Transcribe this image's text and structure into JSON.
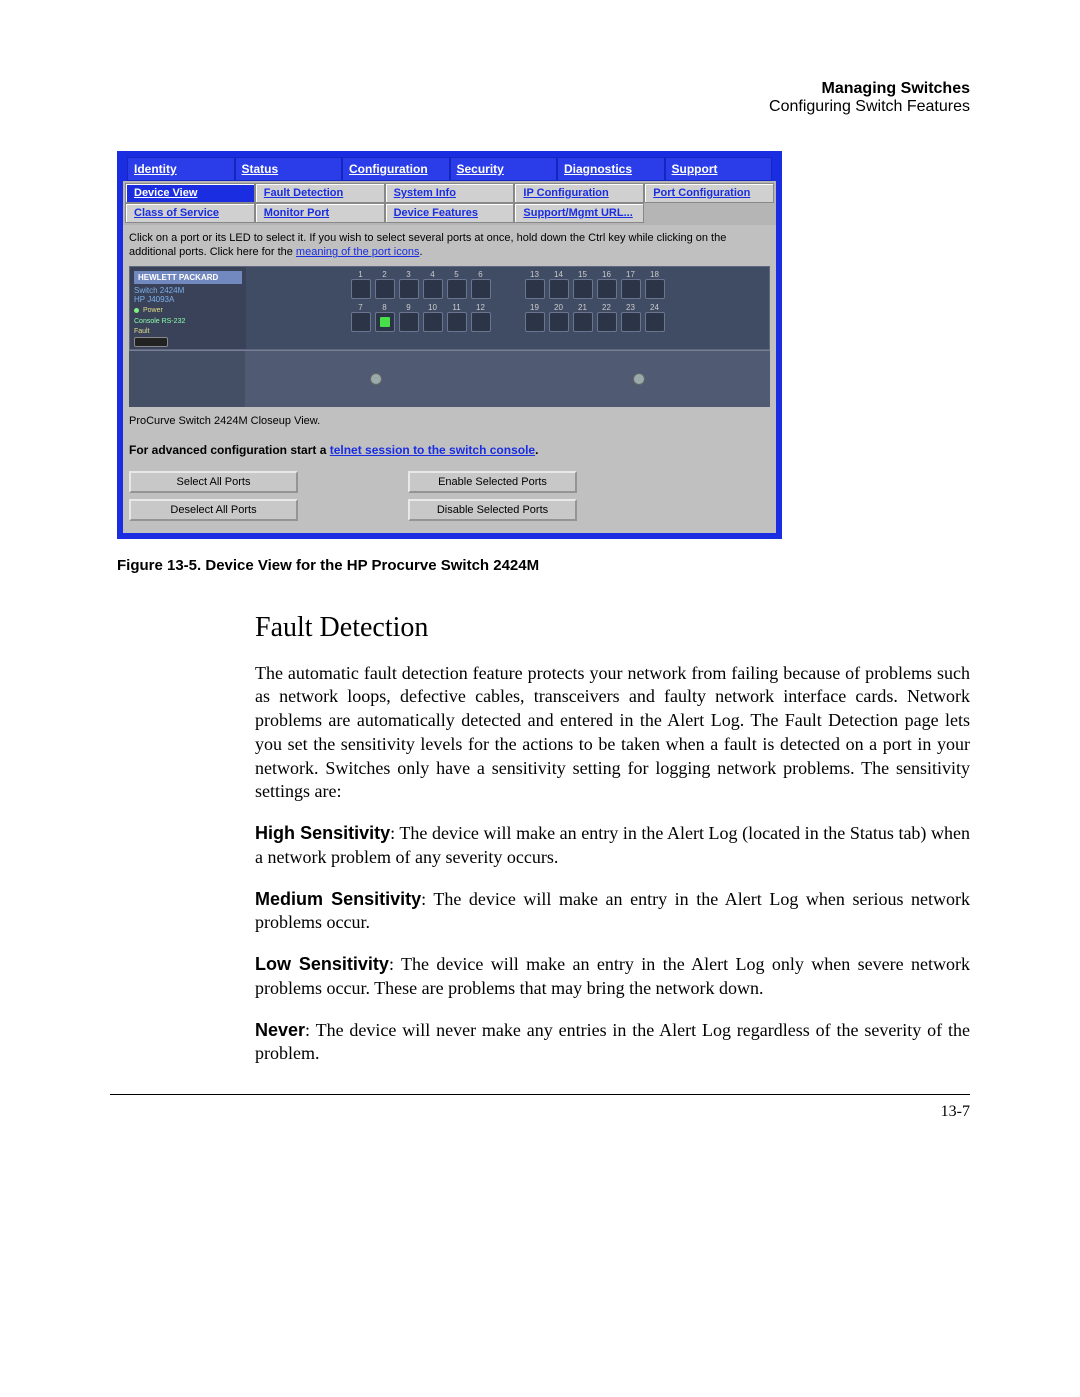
{
  "header": {
    "line1": "Managing Switches",
    "line2": "Configuring Switch Features"
  },
  "screenshot": {
    "top_tabs": [
      "Identity",
      "Status",
      "Configuration",
      "Security",
      "Diagnostics",
      "Support"
    ],
    "sub_tabs_row1": [
      {
        "label": "Device View",
        "active": true
      },
      {
        "label": "Fault Detection",
        "active": false
      },
      {
        "label": "System Info",
        "active": false
      },
      {
        "label": "IP Configuration",
        "active": false
      },
      {
        "label": "Port Configuration",
        "active": false
      }
    ],
    "sub_tabs_row2": [
      {
        "label": "Class of Service",
        "active": false
      },
      {
        "label": "Monitor Port",
        "active": false
      },
      {
        "label": "Device Features",
        "active": false
      },
      {
        "label": "Support/Mgmt URL...",
        "active": false
      }
    ],
    "instruction_pre": "Click on a port or its LED to select it. If you wish to select several ports at once, hold down the Ctrl key while clicking on the additional ports. Click here for the ",
    "instruction_link": "meaning of the port icons",
    "instruction_post": ".",
    "switch": {
      "hp": "HEWLETT PACKARD",
      "model1": "Switch 2424M",
      "model2": "HP J4093A",
      "power": "Power",
      "fault": "Fault",
      "console": "Console RS-232",
      "top_row_a": [
        1,
        2,
        3,
        4,
        5,
        6
      ],
      "top_row_b": [
        13,
        14,
        15,
        16,
        17,
        18
      ],
      "bot_row_a": [
        7,
        8,
        9,
        10,
        11,
        12
      ],
      "bot_row_b": [
        19,
        20,
        21,
        22,
        23,
        24
      ],
      "port_active_a": 8
    },
    "closeup": "ProCurve Switch 2424M Closeup View.",
    "telnet_pre": "For advanced configuration start a ",
    "telnet_link": "telnet session to the switch console",
    "telnet_post": ".",
    "buttons": {
      "select_all": "Select All Ports",
      "enable": "Enable Selected Ports",
      "deselect_all": "Deselect All Ports",
      "disable": "Disable Selected Ports"
    }
  },
  "figure_caption": "Figure 13-5. Device View for the HP Procurve Switch 2424M",
  "body": {
    "heading": "Fault Detection",
    "p1": "The automatic fault detection feature protects your network from failing because of problems such as network loops, defective cables, transceivers and faulty network interface cards. Network problems are automatically detected and entered in the Alert Log. The Fault Detection page lets you set the sensitivity levels for the actions to be taken when a fault is detected on a port in your network. Switches only have a sensitivity setting for logging network problems. The sensitivity settings are:",
    "high_label": "High Sensitivity",
    "high_text": ": The device will make an entry in the Alert Log (located in the Status tab) when a network problem of any severity occurs.",
    "med_label": "Medium Sensitivity",
    "med_text": ": The device will make an entry in the Alert Log when serious network problems occur.",
    "low_label": "Low Sensitivity",
    "low_text": ": The device will make an entry in the Alert Log only when severe network problems occur. These are problems that may bring the network down.",
    "never_label": "Never",
    "never_text": ": The device will never make any entries in the Alert Log regardless of the severity of the problem."
  },
  "footer": "13-7"
}
